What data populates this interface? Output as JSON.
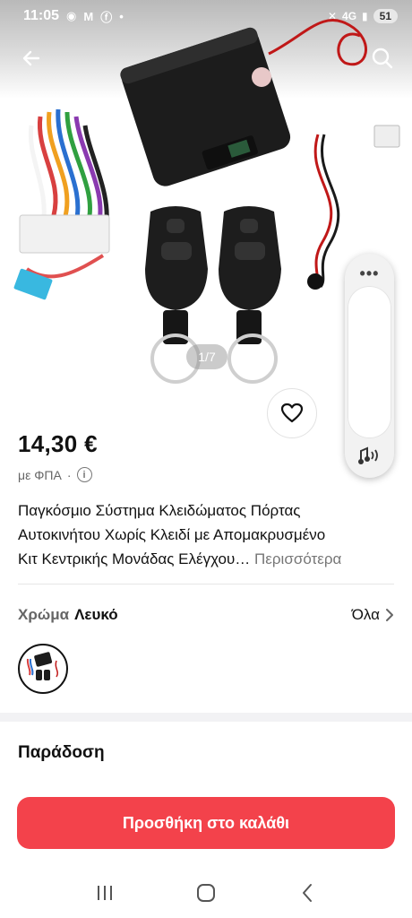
{
  "status_bar": {
    "time": "11:05",
    "network": "4G",
    "battery": "51"
  },
  "gallery": {
    "page_indicator": "1/7"
  },
  "product": {
    "price": "14,30 €",
    "vat_label": "με ΦΠΑ",
    "vat_separator": "·",
    "title_lines": [
      "Παγκόσμιο Σύστημα Κλειδώματος Πόρτας",
      "Αυτοκινήτου Χωρίς Κλειδί με Απομακρυσμένο",
      "Κιτ Κεντρικής Μονάδας Ελέγχου…"
    ],
    "more_label": "Περισσότερα"
  },
  "variant": {
    "label": "Χρώμα",
    "value": "Λευκό",
    "all_label": "Όλα"
  },
  "delivery": {
    "title": "Παράδοση"
  },
  "cart": {
    "button_label": "Προσθήκη στο καλάθι",
    "color": "#f3424b"
  },
  "edge_panel": {
    "dots": "•••"
  },
  "icons": [
    "back-arrow-icon",
    "search-icon",
    "heart-icon",
    "info-icon",
    "chevron-right-icon",
    "sound-icon",
    "recents-icon",
    "home-icon",
    "back-icon"
  ]
}
